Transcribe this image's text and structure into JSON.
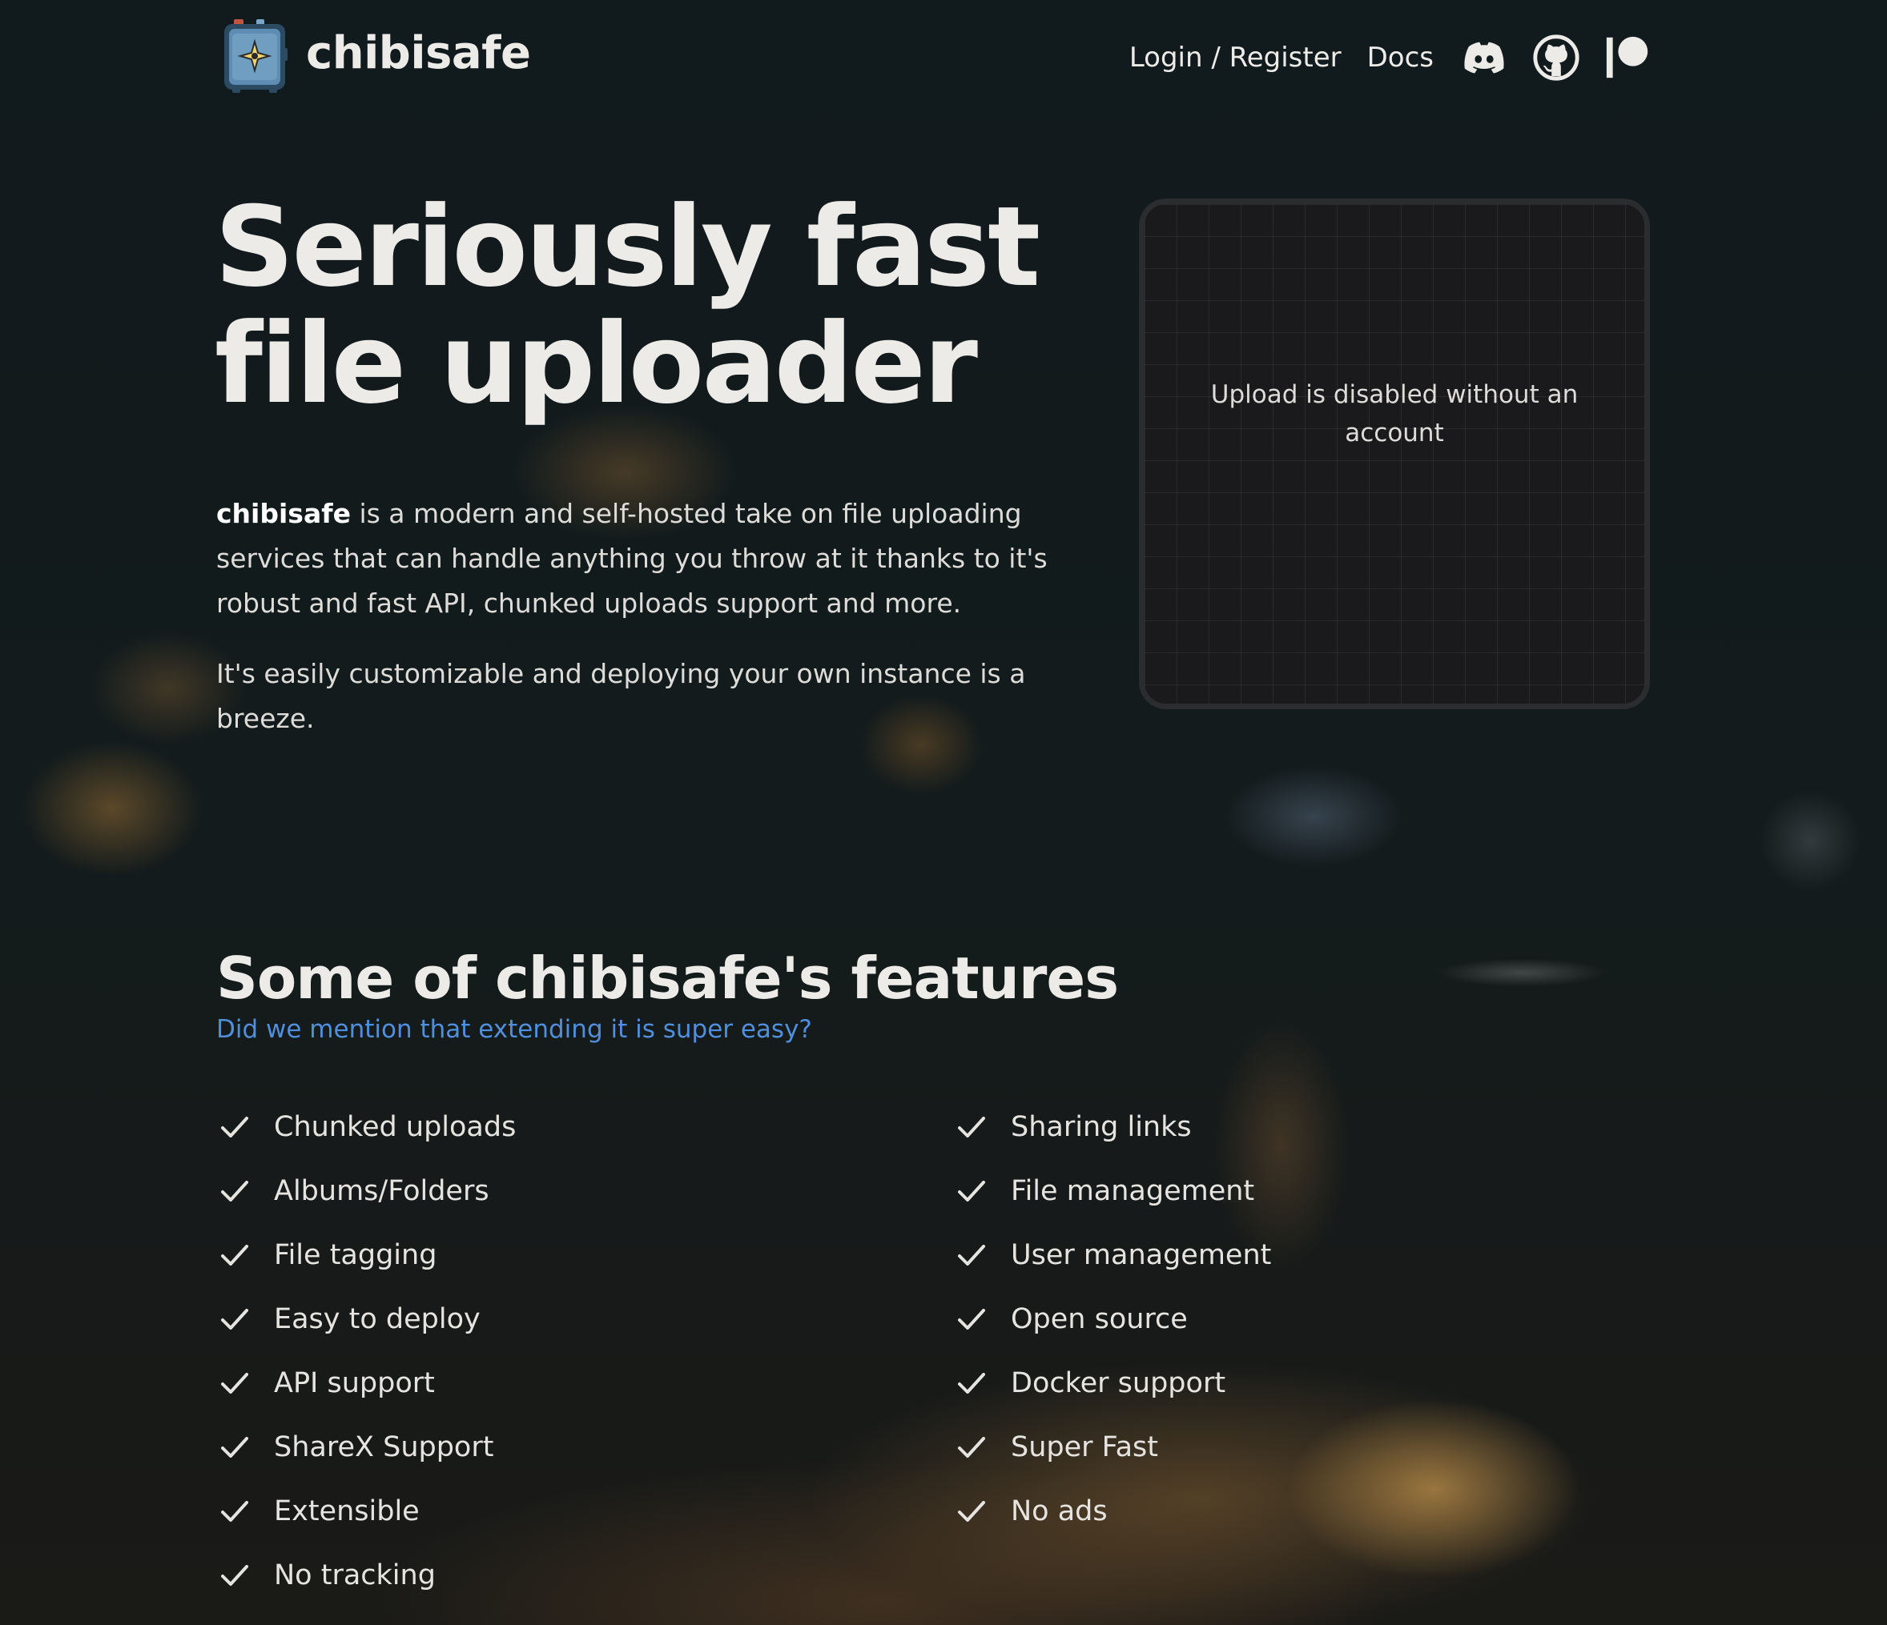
{
  "header": {
    "brand": "chibisafe",
    "nav": {
      "login": "Login / Register",
      "docs": "Docs"
    },
    "icons": [
      "discord-icon",
      "github-icon",
      "patreon-icon"
    ]
  },
  "hero": {
    "title_line1": "Seriously fast",
    "title_line2": "file uploader",
    "description_brand": "chibisafe",
    "description_rest": " is a modern and self-hosted take on file uploading services that can handle anything you throw at it thanks to it's robust and fast API, chunked uploads support and more.",
    "description2": "It's easily customizable and deploying your own instance is a breeze."
  },
  "upload": {
    "message": "Upload is disabled without an account"
  },
  "features": {
    "title": "Some of chibisafe's features",
    "subtitle": "Did we mention that extending it is super easy?",
    "left": [
      "Chunked uploads",
      "Albums/Folders",
      "File tagging",
      "Easy to deploy",
      "API support",
      "ShareX Support",
      "Extensible",
      "No tracking"
    ],
    "right": [
      "Sharing links",
      "File management",
      "User management",
      "Open source",
      "Docker support",
      "Super Fast",
      "No ads"
    ]
  },
  "colors": {
    "background": "#111a1d",
    "text": "#ecebe8",
    "accent_link": "#4f8fdd"
  }
}
